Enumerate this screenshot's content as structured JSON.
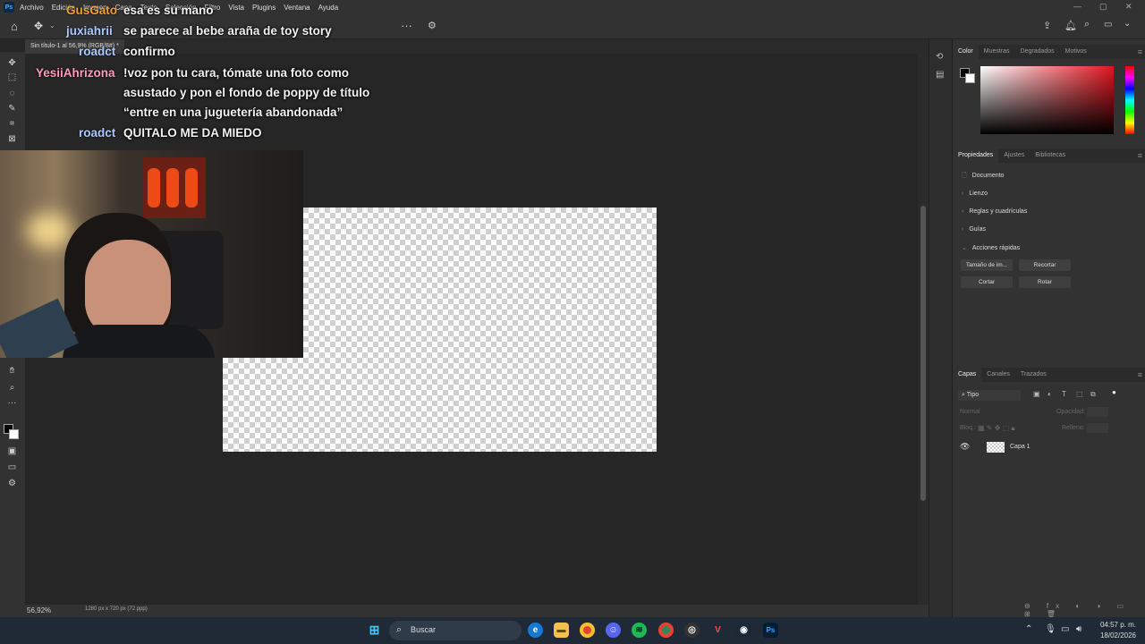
{
  "app": {
    "logo": "Ps",
    "menu": [
      "Archivo",
      "Edición",
      "Imagen",
      "Capa",
      "Texto",
      "Selección",
      "Filtro",
      "Vista",
      "Plugins",
      "Ventana",
      "Ayuda"
    ],
    "document_tab": "Sin título-1 al 56,9% (RGB/8#) *",
    "status_zoom": "56,92%",
    "status_dims": "1280 px x 720 px (72 ppp)"
  },
  "color_panel": {
    "tabs": [
      "Color",
      "Muestras",
      "Degradados",
      "Motivos"
    ],
    "accent_color": "#e3141f"
  },
  "properties_panel": {
    "tabs": [
      "Propiedades",
      "Ajustes",
      "Bibliotecas"
    ],
    "document_label": "Documento",
    "sections": [
      "Lienzo",
      "Reglas y cuadrículas",
      "Guías",
      "Acciones rápidas"
    ],
    "quick_actions": [
      "Tamaño de im...",
      "Recortar",
      "Cortar",
      "Rotar"
    ]
  },
  "layers_panel": {
    "tabs": [
      "Capas",
      "Canales",
      "Trazados"
    ],
    "filter_label": "Tipo",
    "blend_mode": "Normal",
    "opacity_label": "Opacidad:",
    "lock_label": "Bloq.:",
    "fill_label": "Relleno:",
    "layers": [
      {
        "name": "Capa 1",
        "visible": true
      }
    ]
  },
  "chat": [
    {
      "user": "GusGato",
      "color": "#f0a030",
      "message": "esa es su mano"
    },
    {
      "user": "juxiahrii",
      "color": "#a8c8ff",
      "message": "se parece al bebe araña de toy story"
    },
    {
      "user": "roadct",
      "color": "#a8c8ff",
      "message": "confirmo"
    },
    {
      "user": "YesiiAhrizona",
      "color": "#ff9ab8",
      "message": "!voz pon tu cara, tómate una foto como",
      "message2": "asustado y pon el fondo de poppy de título",
      "message3": "“entre en una juguetería abandonada”"
    },
    {
      "user": "roadct",
      "color": "#a8c8ff",
      "message": "QUITALO ME DA MIEDO"
    }
  ],
  "taskbar": {
    "search_placeholder": "Buscar",
    "time": "04:57 p. m.",
    "date": "18/02/2026",
    "apps": [
      "start-icon",
      "edge-icon",
      "file-explorer-icon",
      "chrome-icon",
      "discord-icon",
      "spotify-icon",
      "chrome-profile-icon",
      "obs-icon",
      "valorant-icon",
      "steam-icon",
      "photoshop-icon"
    ]
  }
}
